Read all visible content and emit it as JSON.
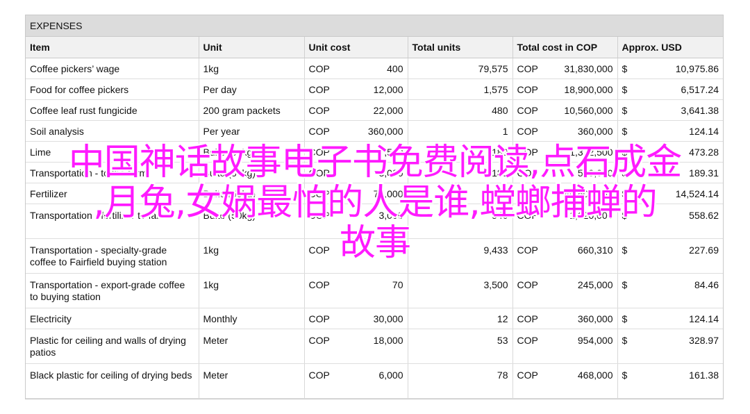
{
  "sheet_title": "EXPENSES",
  "headers": {
    "item": "Item",
    "unit": "Unit",
    "unit_cost": "Unit cost",
    "total_units": "Total units",
    "total_cost": "Total cost in COP",
    "usd": "Approx. USD"
  },
  "rows": [
    {
      "item": "Coffee pickers’ wage",
      "unit": "1kg",
      "cur1": "COP",
      "unit_cost": "400",
      "total_units": "79,575",
      "cur2": "COP",
      "total_cost": "31,830,000",
      "usd_sign": "$",
      "usd": "10,975.86"
    },
    {
      "item": "Food for coffee pickers",
      "unit": "Per day",
      "cur1": "COP",
      "unit_cost": "12,000",
      "total_units": "1,575",
      "cur2": "COP",
      "total_cost": "18,900,000",
      "usd_sign": "$",
      "usd": "6,517.24"
    },
    {
      "item": "Coffee leaf rust fungicide",
      "unit": "200 gram packets",
      "cur1": "COP",
      "unit_cost": "22,000",
      "total_units": "480",
      "cur2": "COP",
      "total_cost": "10,560,000",
      "usd_sign": "$",
      "usd": "3,641.38"
    },
    {
      "item": "Soil analysis",
      "unit": "Per year",
      "cur1": "COP",
      "unit_cost": "360,000",
      "total_units": "1",
      "cur2": "COP",
      "total_cost": "360,000",
      "usd_sign": "$",
      "usd": "124.14"
    },
    {
      "item": "Lime",
      "unit": "Bulto (50kg)",
      "cur1": "COP",
      "unit_cost": "7,500",
      "total_units": "183",
      "cur2": "COP",
      "total_cost": "1,372,500",
      "usd_sign": "$",
      "usd": "473.28"
    },
    {
      "item": "Transportation - to the farm",
      "unit": "Bulto (50kg)",
      "cur1": "COP",
      "unit_cost": "3,000",
      "total_units": "183",
      "cur2": "COP",
      "total_cost": "549,000",
      "usd_sign": "$",
      "usd": "189.31"
    },
    {
      "item": "Fertilizer",
      "unit": "Bulto (50kg)",
      "cur1": "COP",
      "unit_cost": "70,000",
      "total_units": "580",
      "cur2": "COP",
      "total_cost": "40,600,000",
      "usd_sign": "$",
      "usd": "14,524.14"
    },
    {
      "item": "Transportation - fertilizer to farm",
      "unit": "Bulto (50kg)",
      "cur1": "COP",
      "unit_cost": "3,000",
      "total_units": "540",
      "cur2": "COP",
      "total_cost": "1,620,000",
      "usd_sign": "$",
      "usd": "558.62"
    },
    {
      "item": "Transportation - specialty-grade coffee to Fairfield buying station",
      "unit": "1kg",
      "cur1": "COP",
      "unit_cost": "",
      "total_units": "9,433",
      "cur2": "COP",
      "total_cost": "660,310",
      "usd_sign": "$",
      "usd": "227.69"
    },
    {
      "item": "Transportation - export-grade coffee to buying station",
      "unit": "1kg",
      "cur1": "COP",
      "unit_cost": "70",
      "total_units": "3,500",
      "cur2": "COP",
      "total_cost": "245,000",
      "usd_sign": "$",
      "usd": "84.46"
    },
    {
      "item": "Electricity",
      "unit": "Monthly",
      "cur1": "COP",
      "unit_cost": "30,000",
      "total_units": "12",
      "cur2": "COP",
      "total_cost": "360,000",
      "usd_sign": "$",
      "usd": "124.14"
    },
    {
      "item": "Plastic for ceiling and walls of drying patios",
      "unit": "Meter",
      "cur1": "COP",
      "unit_cost": "18,000",
      "total_units": "53",
      "cur2": "COP",
      "total_cost": "954,000",
      "usd_sign": "$",
      "usd": "328.97"
    },
    {
      "item": "Black plastic for ceiling of drying beds",
      "unit": "Meter",
      "cur1": "COP",
      "unit_cost": "6,000",
      "total_units": "78",
      "cur2": "COP",
      "total_cost": "468,000",
      "usd_sign": "$",
      "usd": "161.38"
    }
  ],
  "overlay": {
    "line1": "中国神话故事电子书免费阅读,点石成金",
    "line2": ",月兔,女娲最怕的人是谁,螳螂捕蝉的",
    "line3": "故事",
    "color": "#ff1aff"
  }
}
